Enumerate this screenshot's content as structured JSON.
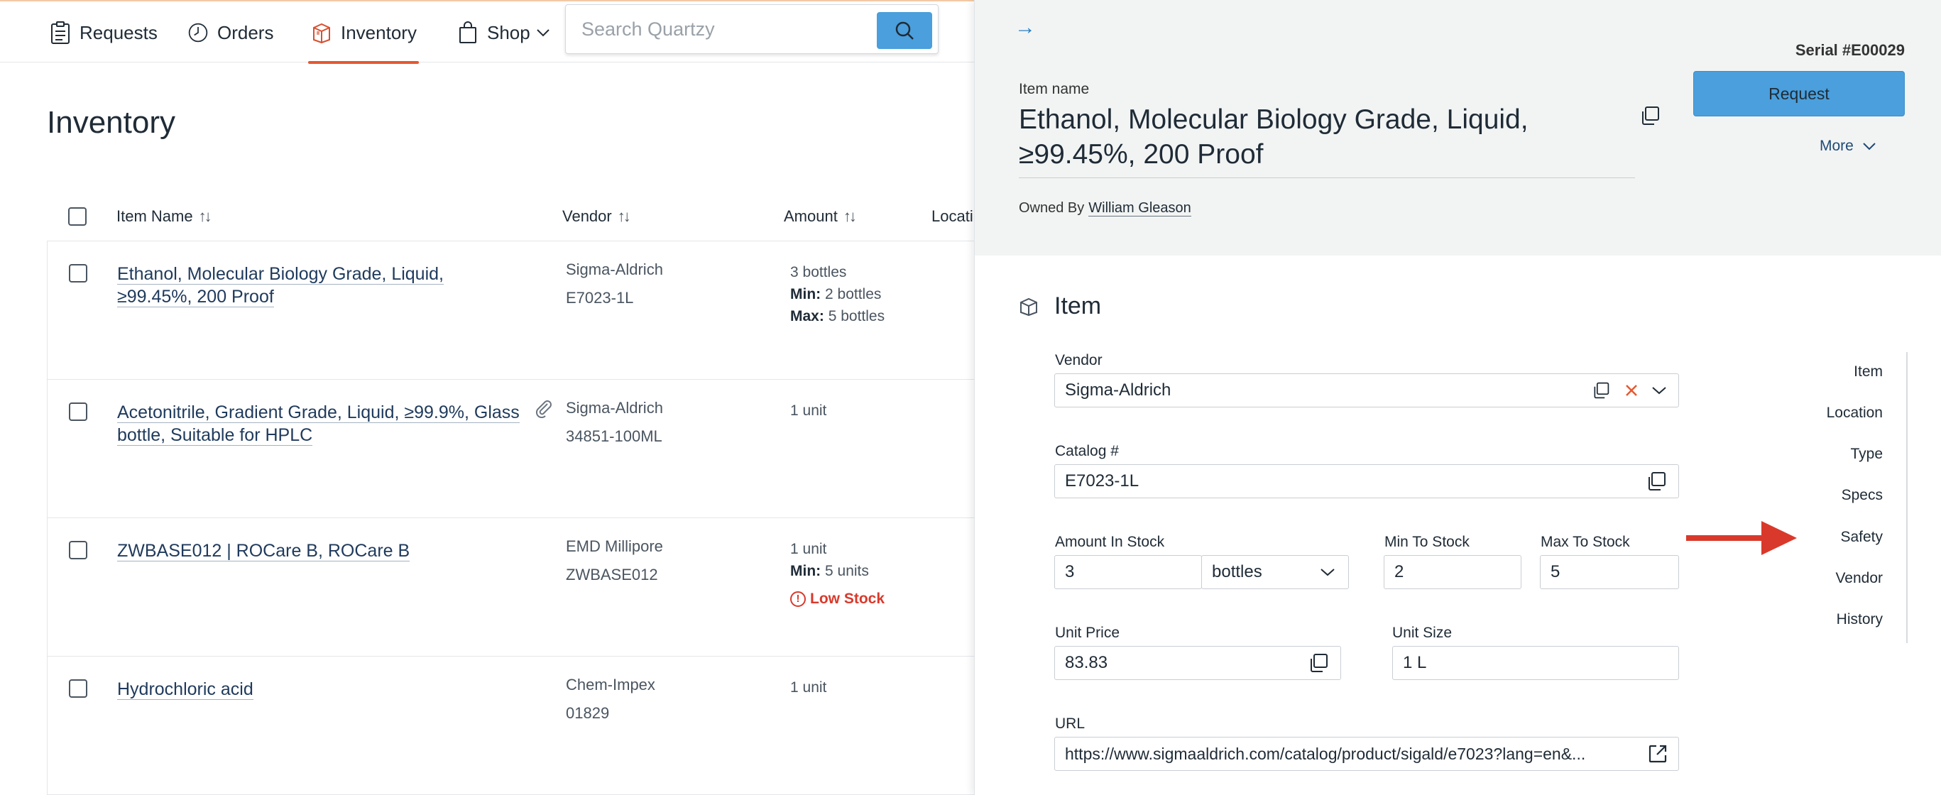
{
  "nav": {
    "items": [
      {
        "label": "Requests",
        "icon": "clipboard-icon"
      },
      {
        "label": "Orders",
        "icon": "clock-icon"
      },
      {
        "label": "Inventory",
        "icon": "box-icon"
      },
      {
        "label": "Shop",
        "icon": "shopping-bag-icon"
      }
    ],
    "active": "Inventory",
    "accent": "#e5582f"
  },
  "search": {
    "placeholder": "Search Quartzy"
  },
  "page": {
    "title": "Inventory"
  },
  "table": {
    "columns": [
      "Item Name",
      "Vendor",
      "Amount",
      "Locati"
    ],
    "rows": [
      {
        "name_line1": "Ethanol, Molecular Biology Grade, Liquid,",
        "name_line2": "≥99.45%, 200 Proof",
        "vendor": "Sigma-Aldrich",
        "catalog": "E7023-1L",
        "amount": "3 bottles",
        "min_label": "Min:",
        "min": "2 bottles",
        "max_label": "Max:",
        "max": "5 bottles"
      },
      {
        "name_line1": "Acetonitrile, Gradient Grade, Liquid, ≥99.9%, Glass",
        "name_line2": "bottle, Suitable for HPLC",
        "vendor": "Sigma-Aldrich",
        "catalog": "34851-100ML",
        "amount": "1 unit",
        "has_attachment": true
      },
      {
        "name_line1": "ZWBASE012 | ROCare B, ROCare B",
        "vendor": "EMD Millipore",
        "catalog": "ZWBASE012",
        "amount": "1 unit",
        "min_label": "Min:",
        "min": "5 units",
        "status": "Low Stock"
      },
      {
        "name_line1": "Hydrochloric acid",
        "vendor": "Chem-Impex",
        "catalog": "01829",
        "amount": "1 unit"
      }
    ]
  },
  "drawer": {
    "close_arrow": "→",
    "serial": "Serial #E00029",
    "request_label": "Request",
    "more_label": "More",
    "item_name_label": "Item name",
    "item_name_line1": "Ethanol, Molecular Biology Grade, Liquid,",
    "item_name_line2": "≥99.45%, 200 Proof",
    "owned_by_label": "Owned By",
    "owned_by": "William Gleason",
    "section_title": "Item",
    "fields": {
      "vendor_label": "Vendor",
      "vendor": "Sigma-Aldrich",
      "catalog_label": "Catalog #",
      "catalog": "E7023-1L",
      "amount_label": "Amount In Stock",
      "amount": "3",
      "amount_unit": "bottles",
      "min_label": "Min To Stock",
      "min": "2",
      "max_label": "Max To Stock",
      "max": "5",
      "price_label": "Unit Price",
      "price": "83.83",
      "size_label": "Unit Size",
      "size": "1 L",
      "url_label": "URL",
      "url": "https://www.sigmaaldrich.com/catalog/product/sigald/e7023?lang=en&..."
    },
    "side_nav": [
      "Item",
      "Location",
      "Type",
      "Specs",
      "Safety",
      "Vendor",
      "History"
    ],
    "highlighted_section": "Safety",
    "button_color": "#4a9fdc",
    "arrow_color": "#d9392b"
  }
}
